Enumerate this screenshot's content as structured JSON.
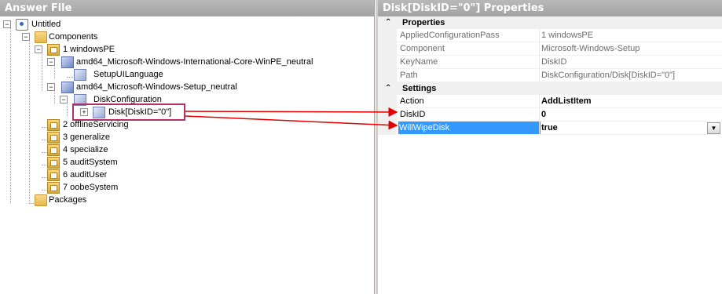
{
  "left_pane": {
    "title": "Answer File"
  },
  "right_pane": {
    "title": "Disk[DiskID=\"0\"] Properties"
  },
  "tree": {
    "root": "Untitled",
    "components": "Components",
    "pass1": "1 windowsPE",
    "comp_intl": "amd64_Microsoft-Windows-International-Core-WinPE_neutral",
    "setup_ui_language": "SetupUILanguage",
    "comp_setup": "amd64_Microsoft-Windows-Setup_neutral",
    "disk_configuration": "DiskConfiguration",
    "disk": "Disk[DiskID=\"0\"]",
    "pass2": "2 offlineServicing",
    "pass3": "3 generalize",
    "pass4": "4 specialize",
    "pass5": "5 auditSystem",
    "pass6": "6 auditUser",
    "pass7": "7 oobeSystem",
    "packages": "Packages"
  },
  "properties": {
    "category_properties": "Properties",
    "category_settings": "Settings",
    "rows": [
      {
        "name": "AppliedConfigurationPass",
        "value": "1 windowsPE"
      },
      {
        "name": "Component",
        "value": "Microsoft-Windows-Setup"
      },
      {
        "name": "KeyName",
        "value": "DiskID"
      },
      {
        "name": "Path",
        "value": "DiskConfiguration/Disk[DiskID=\"0\"]"
      }
    ],
    "settings": [
      {
        "name": "Action",
        "value": "AddListItem"
      },
      {
        "name": "DiskID",
        "value": "0"
      },
      {
        "name": "WillWipeDisk",
        "value": "true"
      }
    ]
  },
  "colors": {
    "highlight": "#b0306a",
    "arrow": "#e00000",
    "selection": "#3399ff"
  }
}
